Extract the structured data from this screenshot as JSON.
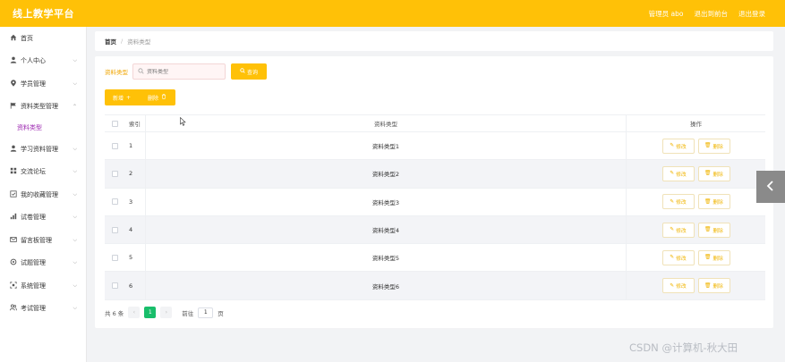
{
  "header": {
    "brand": "线上教学平台",
    "user_label": "管理员 abo",
    "back_label": "退出到前台",
    "logout_label": "退出登录",
    "bg_color": "#ffc107"
  },
  "sidebar": {
    "items": [
      {
        "label": "首页",
        "icon": "home-icon",
        "has_chevron": false
      },
      {
        "label": "个人中心",
        "icon": "user-icon",
        "has_chevron": true
      },
      {
        "label": "学员管理",
        "icon": "pin-icon",
        "has_chevron": true
      },
      {
        "label": "资料类型管理",
        "icon": "flag-icon",
        "has_chevron": true,
        "expanded": true
      },
      {
        "label": "学习资料管理",
        "icon": "user-icon",
        "has_chevron": true
      },
      {
        "label": "交流论坛",
        "icon": "grid-icon",
        "has_chevron": true
      },
      {
        "label": "我的收藏管理",
        "icon": "checkbox-icon",
        "has_chevron": true
      },
      {
        "label": "试卷管理",
        "icon": "chart-icon",
        "has_chevron": true
      },
      {
        "label": "留言板管理",
        "icon": "mail-icon",
        "has_chevron": true
      },
      {
        "label": "试题管理",
        "icon": "settings-icon",
        "has_chevron": true
      },
      {
        "label": "系统管理",
        "icon": "frame-icon",
        "has_chevron": true
      },
      {
        "label": "考试管理",
        "icon": "users-icon",
        "has_chevron": true
      }
    ],
    "sub_item": "资料类型",
    "active_color": "#9c27b0"
  },
  "breadcrumb": {
    "home": "首页",
    "separator": "/",
    "current": "资料类型"
  },
  "search": {
    "label": "资料类型",
    "placeholder": "资料类型",
    "button_label": "查询"
  },
  "actions": {
    "add_label": "新增",
    "delete_label": "删除"
  },
  "table": {
    "columns": [
      "索引",
      "资料类型",
      "操作"
    ],
    "rows": [
      {
        "index": "1",
        "type": "资料类型1"
      },
      {
        "index": "2",
        "type": "资料类型2"
      },
      {
        "index": "3",
        "type": "资料类型3"
      },
      {
        "index": "4",
        "type": "资料类型4"
      },
      {
        "index": "5",
        "type": "资料类型5"
      },
      {
        "index": "6",
        "type": "资料类型6"
      }
    ],
    "edit_label": "修改",
    "delete_label": "删除"
  },
  "pagination": {
    "total_label": "共 6 条",
    "current_page": "1",
    "goto_label": "前往",
    "goto_value": "1",
    "page_suffix": "页",
    "active_color": "#19be6b"
  },
  "watermark": "CSDN @计算机-秋大田"
}
